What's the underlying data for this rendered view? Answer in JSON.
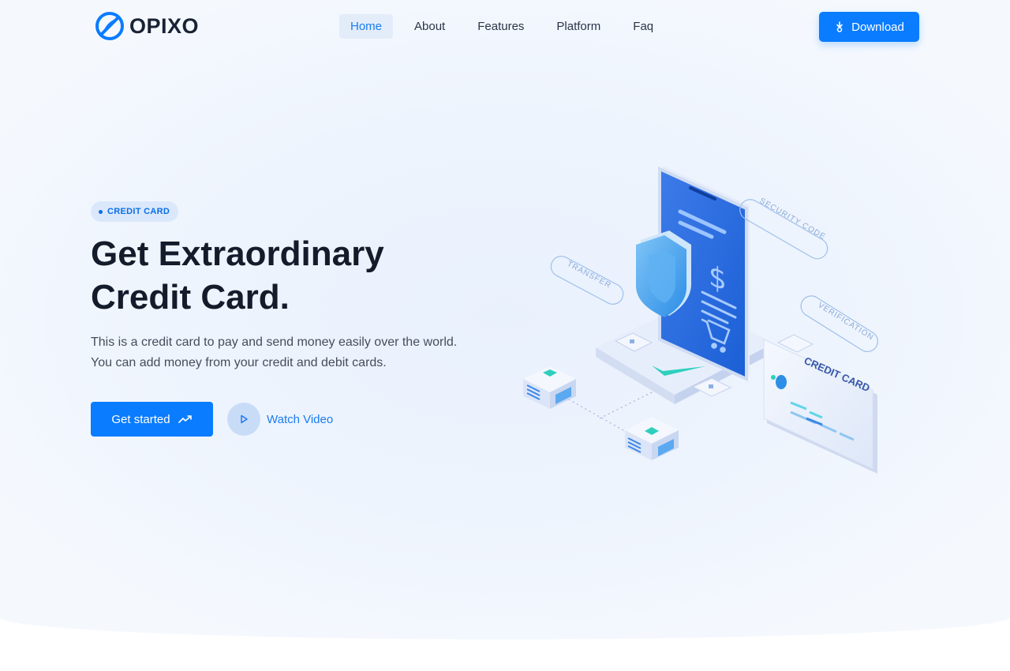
{
  "brand": {
    "name": "OPIXO"
  },
  "nav": {
    "items": [
      {
        "label": "Home",
        "active": true
      },
      {
        "label": "About",
        "active": false
      },
      {
        "label": "Features",
        "active": false
      },
      {
        "label": "Platform",
        "active": false
      },
      {
        "label": "Faq",
        "active": false
      }
    ],
    "download_label": "Download"
  },
  "hero": {
    "badge": "CREDIT CARD",
    "headline_line1": "Get Extraordinary",
    "headline_line2": "Credit Card.",
    "desc_line1": "This is a credit card to pay and send money easily over the world.",
    "desc_line2": "You can add money from your credit and debit cards.",
    "cta_label": "Get started",
    "watch_label": "Watch Video"
  },
  "illustration": {
    "tag_security": "SECURITY CODE",
    "tag_transfer": "TRANSFER",
    "tag_verification": "VERIFICATION",
    "card_label": "CREDIT CARD",
    "currency_symbol": "$"
  },
  "colors": {
    "accent": "#0a7cff",
    "heading": "#141c2b",
    "badge_bg": "#dbe8fb"
  },
  "icons": [
    "logo-icon",
    "download-icon",
    "trending-up-icon",
    "play-icon",
    "shield-icon",
    "cart-icon"
  ]
}
